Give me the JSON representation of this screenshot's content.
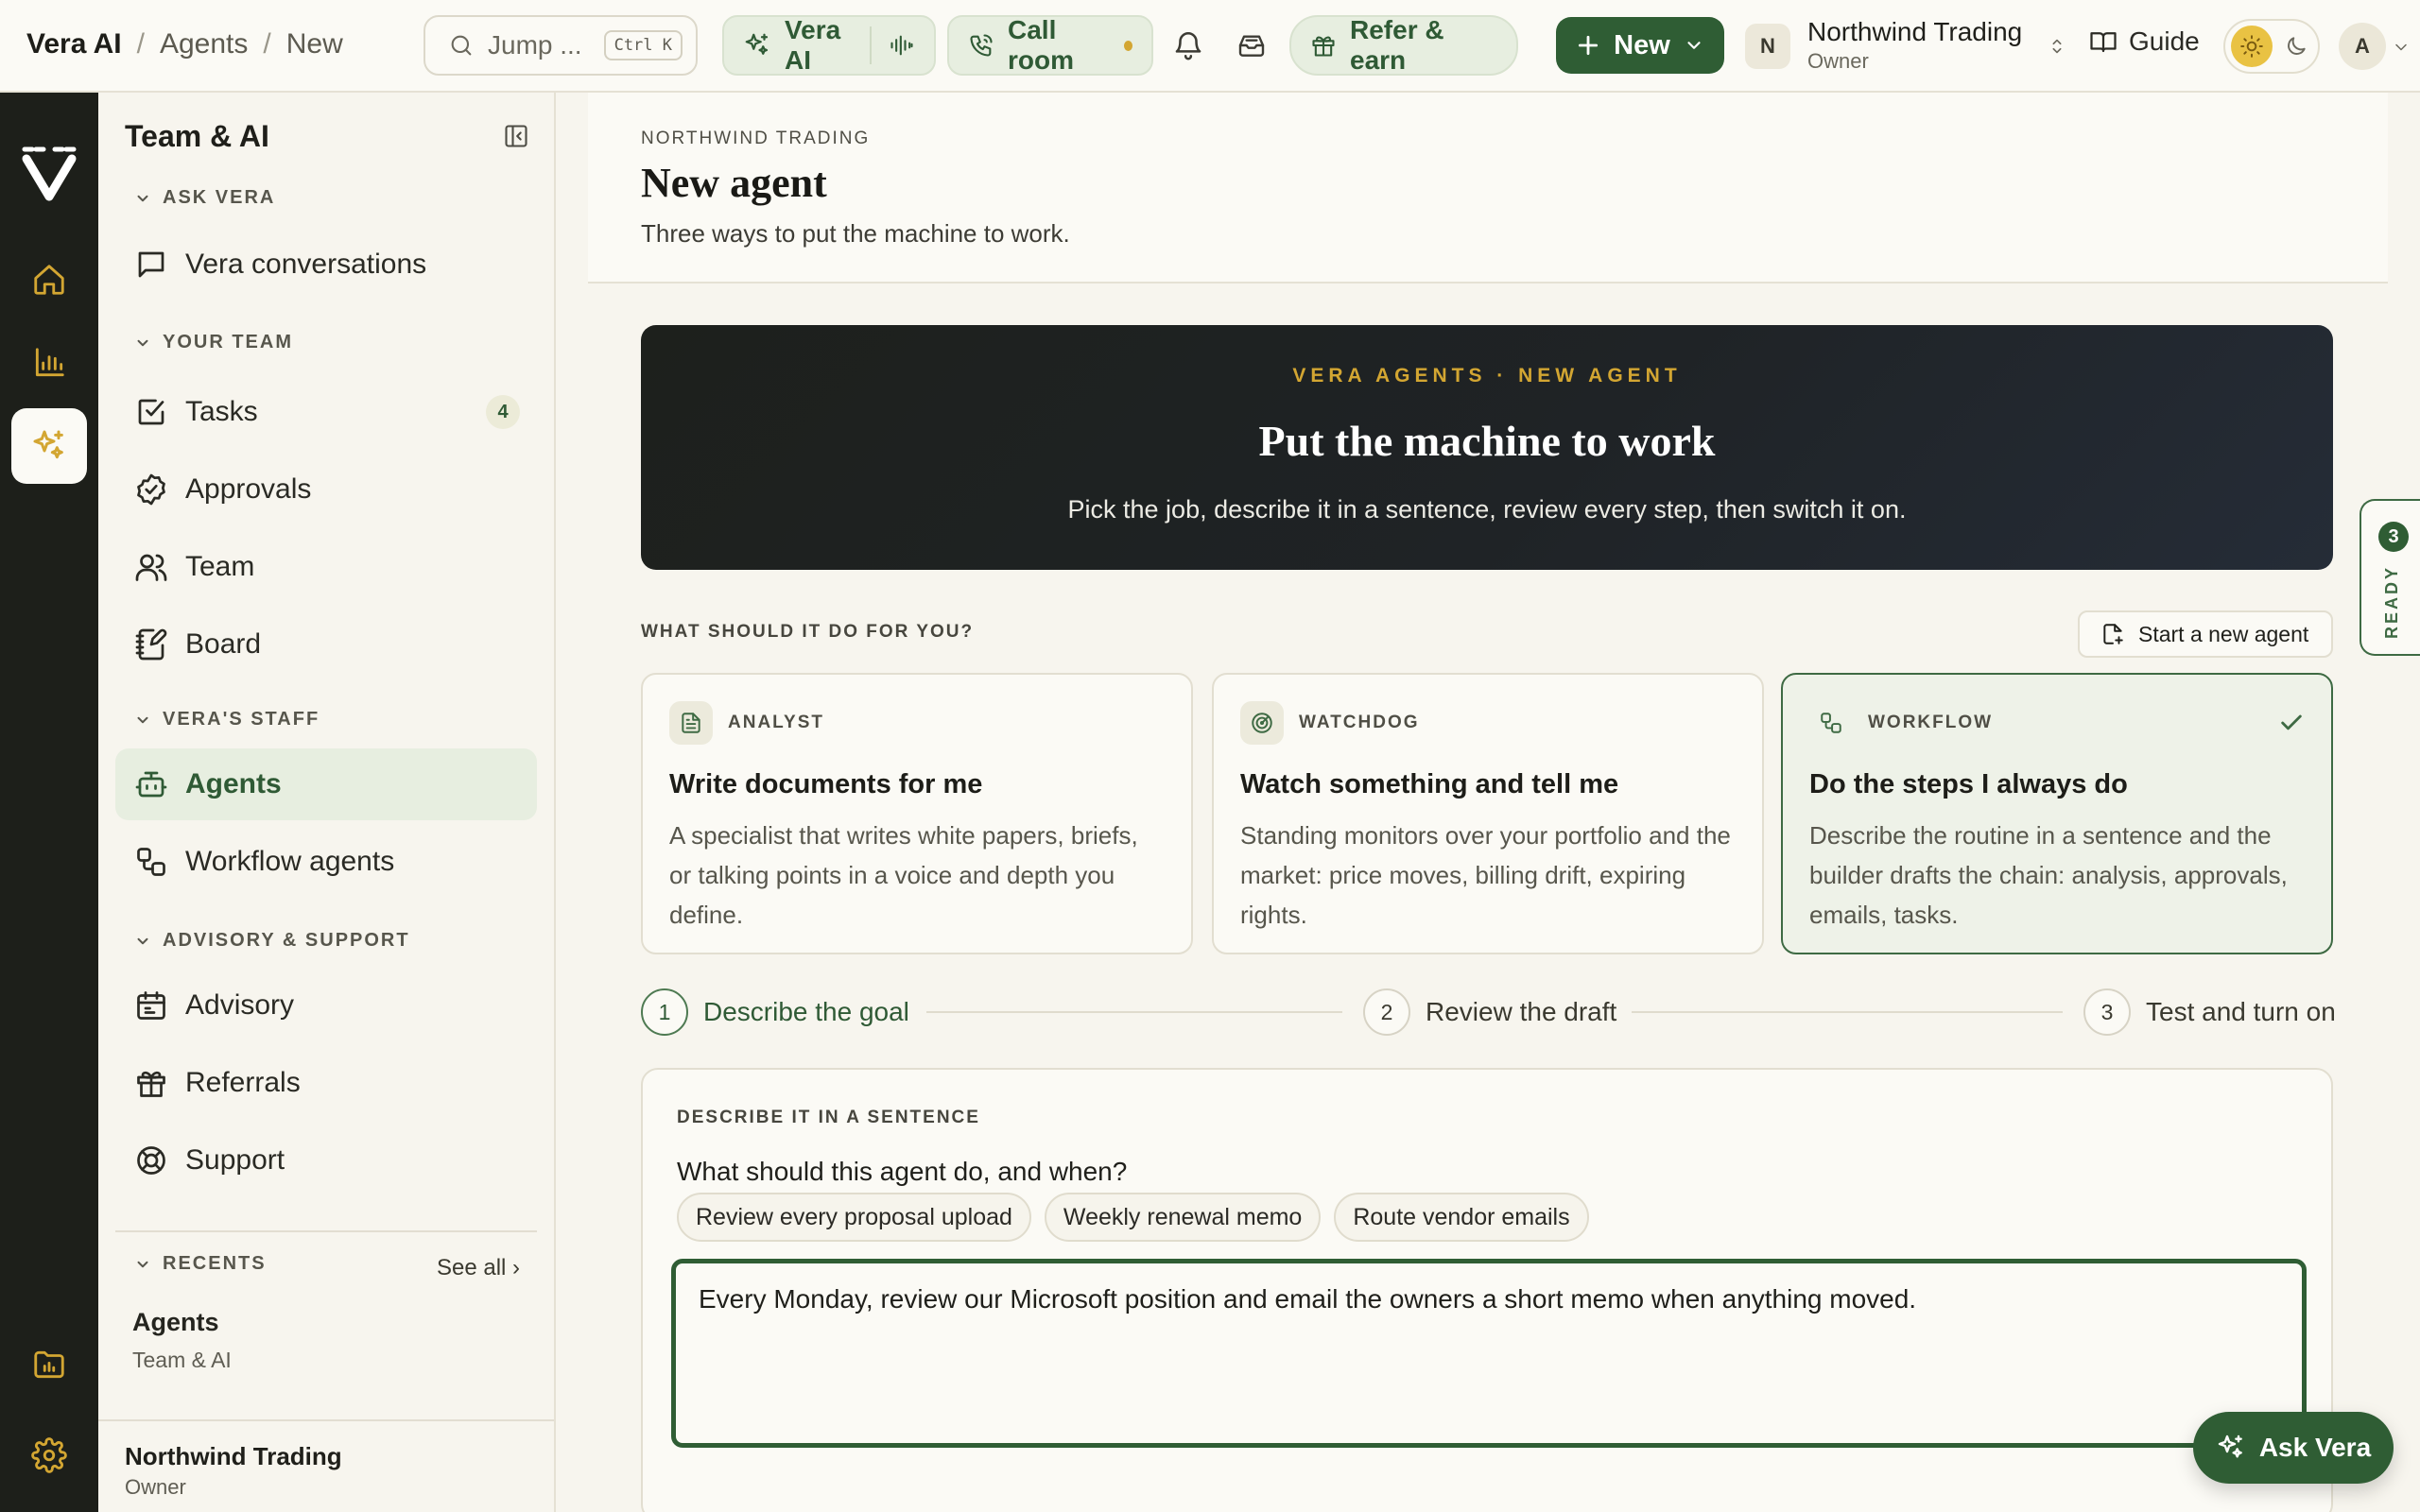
{
  "topbar": {
    "breadcrumb": [
      "Vera AI",
      "Agents",
      "New"
    ],
    "search": {
      "placeholder": "Jump ...",
      "shortcut": "Ctrl K"
    },
    "vera_ai_label": "Vera AI",
    "call_room_label": "Call room",
    "refer_label": "Refer & earn",
    "new_label": "New",
    "org": {
      "badge": "N",
      "name": "Northwind Trading",
      "role": "Owner"
    },
    "guide_label": "Guide",
    "avatar_initial": "A"
  },
  "sidebar": {
    "title": "Team & AI",
    "sections": {
      "ask_vera": "ASK VERA",
      "your_team": "YOUR TEAM",
      "veras_staff": "VERA'S STAFF",
      "advisory": "ADVISORY & SUPPORT",
      "recents": "RECENTS"
    },
    "items": {
      "vera_conversations": "Vera conversations",
      "tasks": "Tasks",
      "tasks_count": "4",
      "approvals": "Approvals",
      "team": "Team",
      "board": "Board",
      "agents": "Agents",
      "workflow_agents": "Workflow agents",
      "advisory": "Advisory",
      "referrals": "Referrals",
      "support": "Support"
    },
    "see_all": "See all ›",
    "recents": [
      {
        "title": "Agents",
        "subtitle": "Team & AI"
      }
    ],
    "footer": {
      "name": "Northwind Trading",
      "role": "Owner"
    }
  },
  "header": {
    "eyebrow": "NORTHWIND TRADING",
    "title": "New agent",
    "subtitle": "Three ways to put the machine to work."
  },
  "hero": {
    "eyebrow": "VERA AGENTS · NEW AGENT",
    "title": "Put the machine to work",
    "description": "Pick the job, describe it in a sentence, review every step, then switch it on."
  },
  "picker": {
    "label": "WHAT SHOULD IT DO FOR YOU?",
    "start_new_label": "Start a new agent",
    "cards": [
      {
        "kind": "ANALYST",
        "title": "Write documents for me",
        "body": "A specialist that writes white papers, briefs, or talking points in a voice and depth you define.",
        "selected": false
      },
      {
        "kind": "WATCHDOG",
        "title": "Watch something and tell me",
        "body": "Standing monitors over your portfolio and the market: price moves, billing drift, expiring rights.",
        "selected": false
      },
      {
        "kind": "WORKFLOW",
        "title": "Do the steps I always do",
        "body": "Describe the routine in a sentence and the builder drafts the chain: analysis, approvals, emails, tasks.",
        "selected": true
      }
    ]
  },
  "steps": [
    {
      "num": "1",
      "label": "Describe the goal",
      "active": true
    },
    {
      "num": "2",
      "label": "Review the draft",
      "active": false
    },
    {
      "num": "3",
      "label": "Test and turn on",
      "active": false
    }
  ],
  "describe": {
    "eyebrow": "DESCRIBE IT IN A SENTENCE",
    "question": "What should this agent do, and when?",
    "chips": [
      "Review every proposal upload",
      "Weekly renewal memo",
      "Route vendor emails"
    ],
    "value": "Every Monday, review our Microsoft position and email the owners a short memo when anything moved."
  },
  "ready_tab": {
    "count": "3",
    "label": "READY"
  },
  "ask_vera_label": "Ask Vera",
  "colors": {
    "brand_green": "#2f5d34",
    "accent_gold": "#d3a632",
    "rail_bg": "#1d1f1a",
    "canvas": "#f7f5ee"
  }
}
